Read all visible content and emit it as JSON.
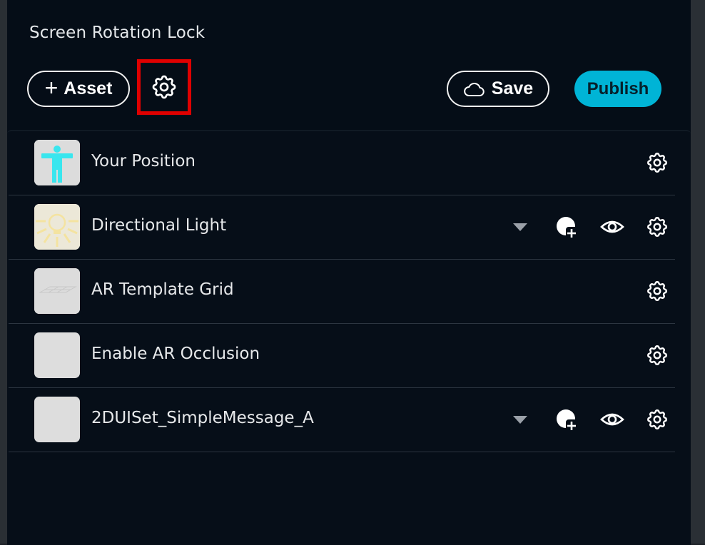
{
  "panel": {
    "title": "Screen Rotation Lock"
  },
  "toolbar": {
    "asset_label": "Asset",
    "save_label": "Save",
    "publish_label": "Publish"
  },
  "colors": {
    "accent": "#00b4d6",
    "highlight": "#e00000",
    "panel_bg": "#050d17"
  },
  "icons": {
    "asset_button": "plus-icon",
    "save_button": "cloud-icon",
    "settings": "gear-icon",
    "visibility": "eye-icon",
    "add": "add-image-icon",
    "expand": "caret-down-icon"
  },
  "assets": [
    {
      "label": "Your Position",
      "thumb": "person-icon"
    },
    {
      "label": "Directional Light",
      "thumb": "light-bulb-icon"
    },
    {
      "label": "AR Template Grid",
      "thumb": "grid-icon"
    },
    {
      "label": "Enable AR Occlusion",
      "thumb": "blank"
    },
    {
      "label": "2DUISet_SimpleMessage_A",
      "thumb": "blank"
    }
  ]
}
